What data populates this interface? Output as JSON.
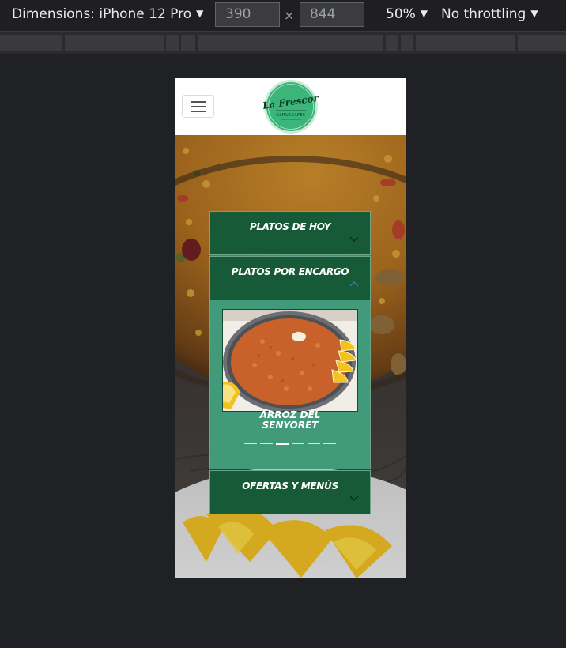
{
  "devtools": {
    "dimensions_label": "Dimensions: iPhone 12 Pro",
    "width": "390",
    "height": "844",
    "separator": "×",
    "zoom": "50%",
    "throttling": "No throttling"
  },
  "header": {
    "logo_text": "La Frescor",
    "logo_subtext": "ALMUSSAFES"
  },
  "accordion": {
    "items": [
      {
        "title": "PLATOS DE HOY",
        "expanded": false
      },
      {
        "title": "PLATOS POR ENCARGO",
        "expanded": true
      },
      {
        "title": "OFERTAS Y MENÚS",
        "expanded": false
      }
    ],
    "active_slide": {
      "caption": "ARROZ DEL SENYORET"
    },
    "slide_count": 6,
    "active_slide_index": 2
  },
  "colors": {
    "accordion_header": "#175a37",
    "accordion_body": "#419a79",
    "devtools_bg": "#202124"
  }
}
